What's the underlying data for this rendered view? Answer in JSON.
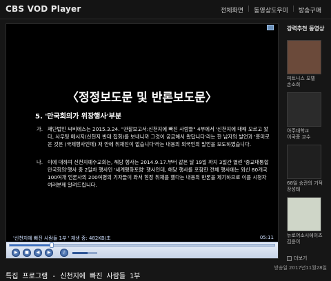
{
  "header": {
    "title": "CBS VOD Player",
    "nav": [
      "전체화면",
      "동영상도우미",
      "방송구매"
    ]
  },
  "slide": {
    "title": "〈정정보도문 및 반론보도문〉",
    "subtitle": "5. '만국회의가 위장행사'부분",
    "para1_label": "가.",
    "para1": "재단법인 씨비에스는 2015.3.24. \"관찰보고서:신천지에 빠진 사람들\" 4부에서 '신천지에 대해 모르고 왔다, 사우팅 메시지(신천지 반대 집회)를 보내니까 그것이 궁금해서 왔답니다'라는 한 남자의 발언과 '흥미로운 것은 (국제행사인데) 저 안에 취재진이 없습니다'라는 내용의 외국인의 발언을 보도하였습니다.",
    "para2_label": "나.",
    "para2": "이에 대하여 신천지예수교회는, 해당 행사는 2014.9.17.부터 같은 달 19일 까지 3일간 열린 '종교대통합만국회의'행사 중 2일차 행사인 '세계평화포럼' 행사인데, 해당 행사를 포함한 전체 행사에는 외신 80개국 100여개 언론사의 200여명의 기자들이 와서 현장 취재를 했다는 내용의 반론을 제기하므로 이를 시청자 여러분께 알려드립니다."
  },
  "player": {
    "caption_left": "'신천지에 빠진 사람들 1부 ' 재생 중: 482KB/초",
    "time": "05:11",
    "progress": 0.16,
    "volume": 0.6,
    "buttons": [
      "play-icon",
      "stop-icon",
      "prev-icon",
      "next-icon",
      "volume-icon"
    ]
  },
  "program": {
    "title": "특집 프로그램 - 신천지에 빠진 사람들 1부",
    "date": "방송일 2017년11월28일"
  },
  "sidebar": {
    "heading": "강력추천 동영상",
    "items": [
      {
        "line1": "피트니스 모델",
        "line2": "손소희",
        "bg": "#6b4a3a"
      },
      {
        "line1": "아주대학교",
        "line2": "이국종 교수",
        "bg": "#2b2b2b"
      },
      {
        "line1": "68일 승관의 기적",
        "line2": "장성태",
        "bg": "#1f1f1f"
      },
      {
        "line1": "뉴로어소시에이츠",
        "line2": "김윤이",
        "bg": "#cfd6c8"
      }
    ],
    "more_label": "더보기"
  },
  "colors": {
    "accent": "#3c6fbf",
    "background": "#161616"
  }
}
